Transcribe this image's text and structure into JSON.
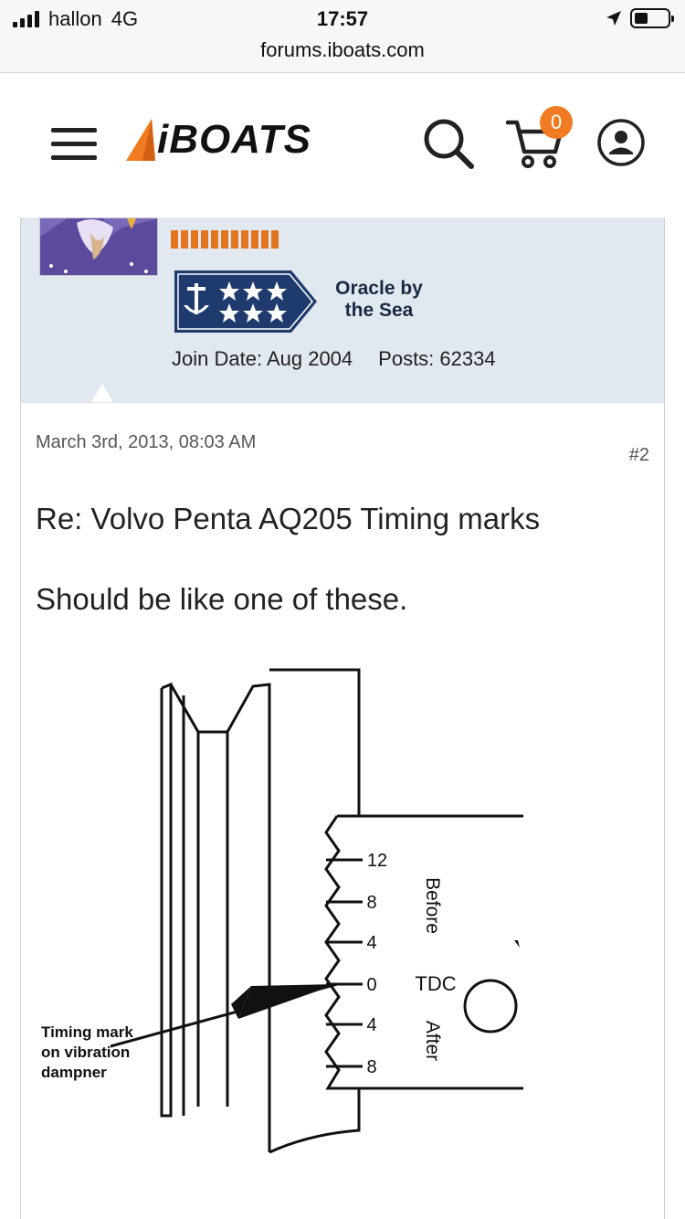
{
  "status_bar": {
    "carrier": "hallon",
    "network": "4G",
    "time": "17:57",
    "url": "forums.iboats.com"
  },
  "header": {
    "logo_text": "iBOATS",
    "cart_count": "0",
    "accent_color": "#f07b22"
  },
  "profile": {
    "rank_title": "Oracle by the Sea",
    "rank_line1": "Oracle by",
    "rank_line2": "the Sea",
    "join_date": "Join Date: Aug 2004",
    "posts": "Posts: 62334"
  },
  "post": {
    "date": "March 3rd, 2013, 08:03 AM",
    "number": "#2",
    "title": "Re: Volvo Penta AQ205 Timing marks",
    "body": "Should be like one of these.",
    "diagram": {
      "scale_labels": [
        "12",
        "8",
        "4",
        "0",
        "4",
        "8"
      ],
      "tdc_label": "TDC",
      "before_label": "Before",
      "after_label": "After",
      "callout_line1": "Timing mark",
      "callout_line2": "on vibration",
      "callout_line3": "dampner"
    }
  }
}
